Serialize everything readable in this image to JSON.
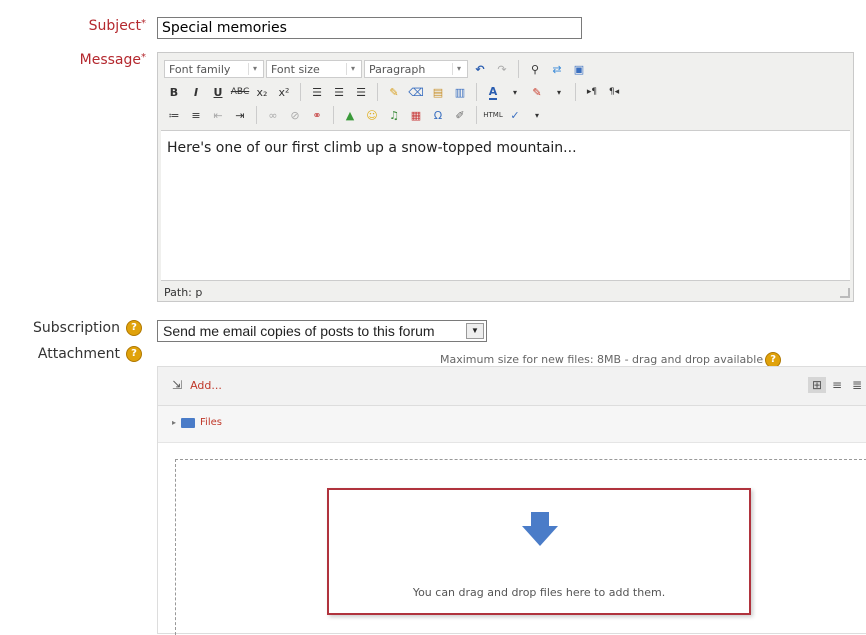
{
  "form": {
    "subject_label": "Subject",
    "subject_value": "Special memories",
    "message_label": "Message",
    "required_mark": "*",
    "subscription_label": "Subscription",
    "attachment_label": "Attachment"
  },
  "editor": {
    "font_family": "Font family",
    "font_size": "Font size",
    "paragraph": "Paragraph",
    "content": "Here's one of our first climb up a snow-topped mountain...",
    "path": "Path: p"
  },
  "subscription": {
    "selected": "Send me email copies of posts to this forum"
  },
  "attachment": {
    "max_size": "Maximum size for new files: 8MB - drag and drop available",
    "add_label": "Add...",
    "files_label": "Files",
    "drop_hint": "You can drag and drop files here to add them."
  },
  "colors": {
    "label_red": "#b4282e",
    "help_orange": "#e0a20b",
    "drop_highlight": "#b0333d",
    "arrow_blue": "#4a7cc8"
  }
}
